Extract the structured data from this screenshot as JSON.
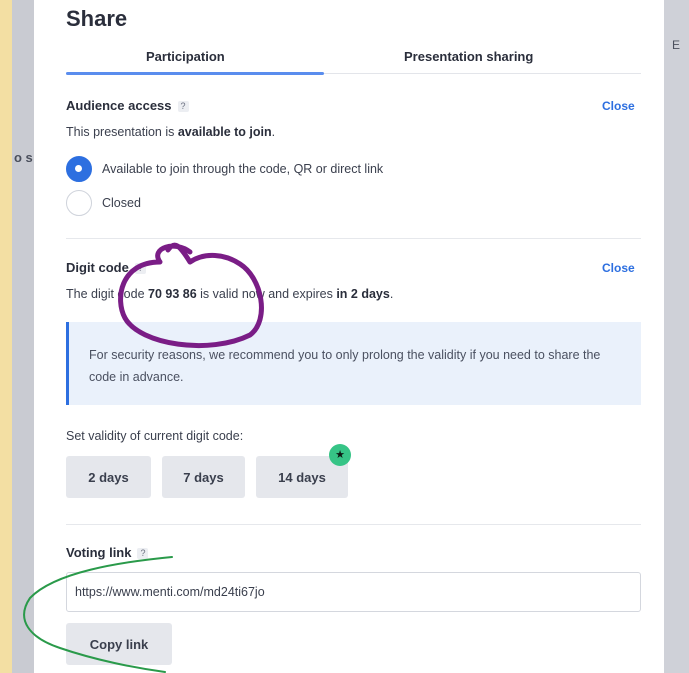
{
  "backdrop": {
    "left_fragment": "o s",
    "right_fragment": "E"
  },
  "modal": {
    "title": "Share",
    "tabs": [
      {
        "label": "Participation",
        "active": true
      },
      {
        "label": "Presentation sharing",
        "active": false
      }
    ]
  },
  "audience_access": {
    "title": "Audience access",
    "help": "?",
    "close_label": "Close",
    "status_prefix": "This presentation is ",
    "status_bold": "available to join",
    "status_suffix": ".",
    "options": [
      {
        "label": "Available to join through the code, QR or direct link",
        "selected": true
      },
      {
        "label": "Closed",
        "selected": false
      }
    ]
  },
  "digit_code": {
    "title": "Digit code",
    "help": "?",
    "close_label": "Close",
    "line_prefix": "The digit code ",
    "code": "70 93 86",
    "line_middle": " is valid now and expires ",
    "expiry": "in 2 days",
    "line_suffix": ".",
    "info": "For security reasons, we recommend you to only prolong the validity if you need to share the code in advance.",
    "validity_label": "Set validity of current digit code:",
    "validity_buttons": [
      "2 days",
      "7 days",
      "14 days"
    ],
    "badge_icon": "star-icon",
    "badge_glyph": "★"
  },
  "voting_link": {
    "title": "Voting link",
    "help": "?",
    "url": "https://www.menti.com/md24ti67jo",
    "copy_label": "Copy link"
  },
  "colors": {
    "accent": "#2d6fe0",
    "badge": "#36c486",
    "annotation_purple": "#7a1d86",
    "annotation_green": "#2a9a4a",
    "page_background": "#f3dfa3"
  }
}
